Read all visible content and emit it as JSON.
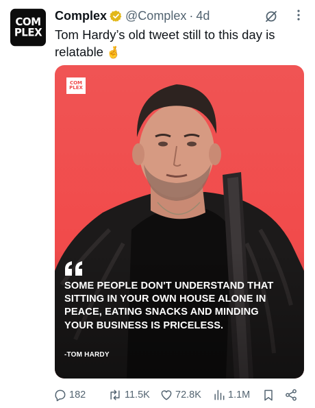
{
  "tweet": {
    "avatar_line1": "COM",
    "avatar_line2": "PLEX",
    "display_name": "Complex",
    "handle": "@Complex",
    "separator": "·",
    "time": "4d",
    "text": "Tom Hardy’s old tweet still to this day is relatable",
    "emoji": "🤞"
  },
  "media": {
    "logo_line1": "COM",
    "logo_line2": "PLEX",
    "quote": "Some people don't understand that sitting in your own house alone in peace, eating snacks and minding your business is priceless.",
    "author": "-TOM HARDY"
  },
  "actions": {
    "replies": "182",
    "reposts": "11.5K",
    "likes": "72.8K",
    "views": "1.1M"
  },
  "colors": {
    "accent": "#1d9bf0",
    "verified_gold": "#e2b719",
    "media_red": "#f05454",
    "muted_text": "#536471"
  }
}
